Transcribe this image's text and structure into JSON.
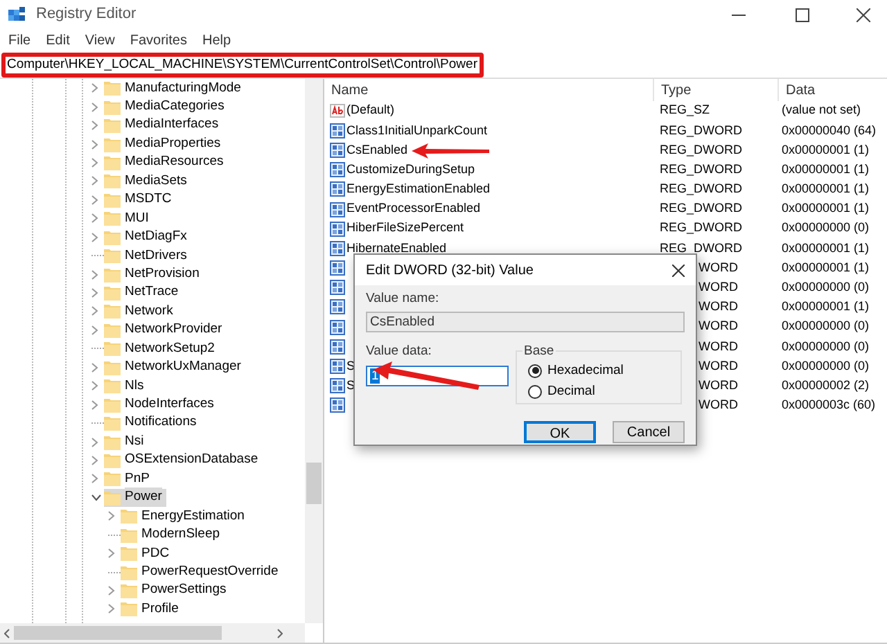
{
  "window": {
    "title": "Registry Editor"
  },
  "menu": [
    "File",
    "Edit",
    "View",
    "Favorites",
    "Help"
  ],
  "address": "Computer\\HKEY_LOCAL_MACHINE\\SYSTEM\\CurrentControlSet\\Control\\Power",
  "tree": [
    {
      "label": "ManufacturingMode",
      "kind": "branch",
      "expanded": false,
      "selected": false
    },
    {
      "label": "MediaCategories",
      "kind": "branch",
      "expanded": false,
      "selected": false
    },
    {
      "label": "MediaInterfaces",
      "kind": "branch",
      "expanded": false,
      "selected": false
    },
    {
      "label": "MediaProperties",
      "kind": "branch",
      "expanded": false,
      "selected": false
    },
    {
      "label": "MediaResources",
      "kind": "branch",
      "expanded": false,
      "selected": false
    },
    {
      "label": "MediaSets",
      "kind": "branch",
      "expanded": false,
      "selected": false
    },
    {
      "label": "MSDTC",
      "kind": "branch",
      "expanded": false,
      "selected": false
    },
    {
      "label": "MUI",
      "kind": "branch",
      "expanded": false,
      "selected": false
    },
    {
      "label": "NetDiagFx",
      "kind": "branch",
      "expanded": false,
      "selected": false
    },
    {
      "label": "NetDrivers",
      "kind": "leaf",
      "selected": false
    },
    {
      "label": "NetProvision",
      "kind": "branch",
      "expanded": false,
      "selected": false
    },
    {
      "label": "NetTrace",
      "kind": "branch",
      "expanded": false,
      "selected": false
    },
    {
      "label": "Network",
      "kind": "branch",
      "expanded": false,
      "selected": false
    },
    {
      "label": "NetworkProvider",
      "kind": "branch",
      "expanded": false,
      "selected": false
    },
    {
      "label": "NetworkSetup2",
      "kind": "leaf",
      "selected": false
    },
    {
      "label": "NetworkUxManager",
      "kind": "branch",
      "expanded": false,
      "selected": false
    },
    {
      "label": "Nls",
      "kind": "branch",
      "expanded": false,
      "selected": false
    },
    {
      "label": "NodeInterfaces",
      "kind": "branch",
      "expanded": false,
      "selected": false
    },
    {
      "label": "Notifications",
      "kind": "leaf",
      "selected": false
    },
    {
      "label": "Nsi",
      "kind": "branch",
      "expanded": false,
      "selected": false
    },
    {
      "label": "OSExtensionDatabase",
      "kind": "branch",
      "expanded": false,
      "selected": false
    },
    {
      "label": "PnP",
      "kind": "branch",
      "expanded": false,
      "selected": false
    },
    {
      "label": "Power",
      "kind": "branch",
      "expanded": true,
      "selected": true,
      "children": [
        {
          "label": "EnergyEstimation",
          "kind": "branch",
          "expanded": false,
          "selected": false
        },
        {
          "label": "ModernSleep",
          "kind": "leaf",
          "selected": false
        },
        {
          "label": "PDC",
          "kind": "branch",
          "expanded": false,
          "selected": false
        },
        {
          "label": "PowerRequestOverride",
          "kind": "leaf",
          "selected": false
        },
        {
          "label": "PowerSettings",
          "kind": "branch",
          "expanded": false,
          "selected": false
        },
        {
          "label": "Profile",
          "kind": "branch",
          "expanded": false,
          "selected": false
        }
      ]
    }
  ],
  "values": {
    "columns": [
      "Name",
      "Type",
      "Data"
    ],
    "rows": [
      {
        "kind": "string",
        "covered": false,
        "name": "(Default)",
        "type": "REG_SZ",
        "data": "(value not set)"
      },
      {
        "kind": "dword",
        "covered": false,
        "name": "Class1InitialUnparkCount",
        "type": "REG_DWORD",
        "data": "0x00000040 (64)"
      },
      {
        "kind": "dword",
        "covered": false,
        "name": "CsEnabled",
        "type": "REG_DWORD",
        "data": "0x00000001 (1)"
      },
      {
        "kind": "dword",
        "covered": false,
        "name": "CustomizeDuringSetup",
        "type": "REG_DWORD",
        "data": "0x00000001 (1)"
      },
      {
        "kind": "dword",
        "covered": false,
        "name": "EnergyEstimationEnabled",
        "type": "REG_DWORD",
        "data": "0x00000001 (1)"
      },
      {
        "kind": "dword",
        "covered": false,
        "name": "EventProcessorEnabled",
        "type": "REG_DWORD",
        "data": "0x00000001 (1)"
      },
      {
        "kind": "dword",
        "covered": false,
        "name": "HiberFileSizePercent",
        "type": "REG_DWORD",
        "data": "0x00000000 (0)"
      },
      {
        "kind": "dword",
        "covered": false,
        "name": "HibernateEnabled",
        "type": "REG_DWORD",
        "data": "0x00000001 (1)"
      },
      {
        "kind": "dword",
        "covered": true,
        "type": "WORD",
        "data": "0x00000001 (1)"
      },
      {
        "kind": "dword",
        "covered": true,
        "type": "WORD",
        "data": "0x00000000 (0)"
      },
      {
        "kind": "dword",
        "covered": true,
        "type": "WORD",
        "data": "0x00000001 (1)"
      },
      {
        "kind": "dword",
        "covered": true,
        "type": "WORD",
        "data": "0x00000000 (0)"
      },
      {
        "kind": "dword",
        "covered": true,
        "type": "WORD",
        "data": "0x00000000 (0)"
      },
      {
        "kind": "dword",
        "covered": true,
        "name": "S",
        "type": "WORD",
        "data": "0x00000000 (0)"
      },
      {
        "kind": "dword",
        "covered": true,
        "name": "S",
        "type": "WORD",
        "data": "0x00000002 (2)"
      },
      {
        "kind": "dword",
        "covered": true,
        "type": "WORD",
        "data": "0x0000003c (60)"
      }
    ]
  },
  "dialog": {
    "title": "Edit DWORD (32-bit) Value",
    "value_name_label": "Value name:",
    "value_name": "CsEnabled",
    "value_data_label": "Value data:",
    "value_data": "1",
    "base_label": "Base",
    "base_options": [
      {
        "label": "Hexadecimal",
        "selected": true
      },
      {
        "label": "Decimal",
        "selected": false
      }
    ],
    "buttons": [
      {
        "label": "OK",
        "default": true
      },
      {
        "label": "Cancel",
        "default": false
      }
    ]
  }
}
